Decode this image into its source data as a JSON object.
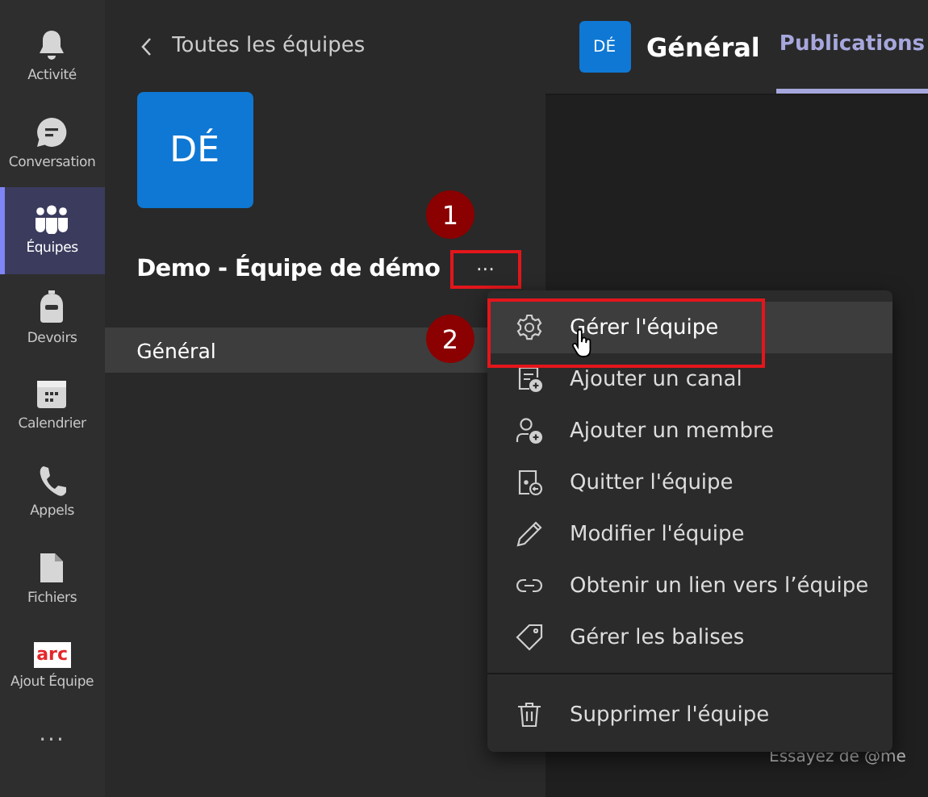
{
  "app_bar": [
    {
      "label": "Activité",
      "kind": "bell",
      "selected": false
    },
    {
      "label": "Conversation",
      "kind": "chat",
      "selected": false
    },
    {
      "label": "Équipes",
      "kind": "people",
      "selected": true
    },
    {
      "label": "Devoirs",
      "kind": "backpack",
      "selected": false
    },
    {
      "label": "Calendrier",
      "kind": "calendar",
      "selected": false
    },
    {
      "label": "Appels",
      "kind": "phone",
      "selected": false
    },
    {
      "label": "Fichiers",
      "kind": "file",
      "selected": false
    },
    {
      "label": "Ajout Équipe",
      "kind": "app",
      "logo_text": "arc",
      "selected": false
    }
  ],
  "app_bar_more": "···",
  "team_panel": {
    "back_link": "Toutes les équipes",
    "avatar": "DÉ",
    "team_name": "Demo - Équipe de démo",
    "more_button": "···",
    "channels": [
      {
        "name": "Général",
        "selected": true
      }
    ]
  },
  "channel_header": {
    "avatar": "DÉ",
    "title": "Général",
    "tabs": [
      {
        "label": "Publications",
        "selected": true
      }
    ]
  },
  "compose_hint": "Essayez de @me",
  "context_menu": [
    {
      "label": "Gérer l'équipe",
      "kind": "gear",
      "selected": true
    },
    {
      "label": "Ajouter un canal",
      "kind": "channel-add",
      "selected": false
    },
    {
      "label": "Ajouter un membre",
      "kind": "person-add",
      "selected": false
    },
    {
      "label": "Quitter l'équipe",
      "kind": "leave",
      "selected": false
    },
    {
      "label": "Modifier l'équipe",
      "kind": "pencil",
      "selected": false
    },
    {
      "label": "Obtenir un lien vers l’équipe",
      "kind": "link",
      "selected": false
    },
    {
      "label": "Gérer les balises",
      "kind": "tag",
      "selected": false
    },
    {
      "label": "Supprimer l'équipe",
      "kind": "trash",
      "selected": false
    }
  ],
  "callouts": [
    "1",
    "2"
  ]
}
